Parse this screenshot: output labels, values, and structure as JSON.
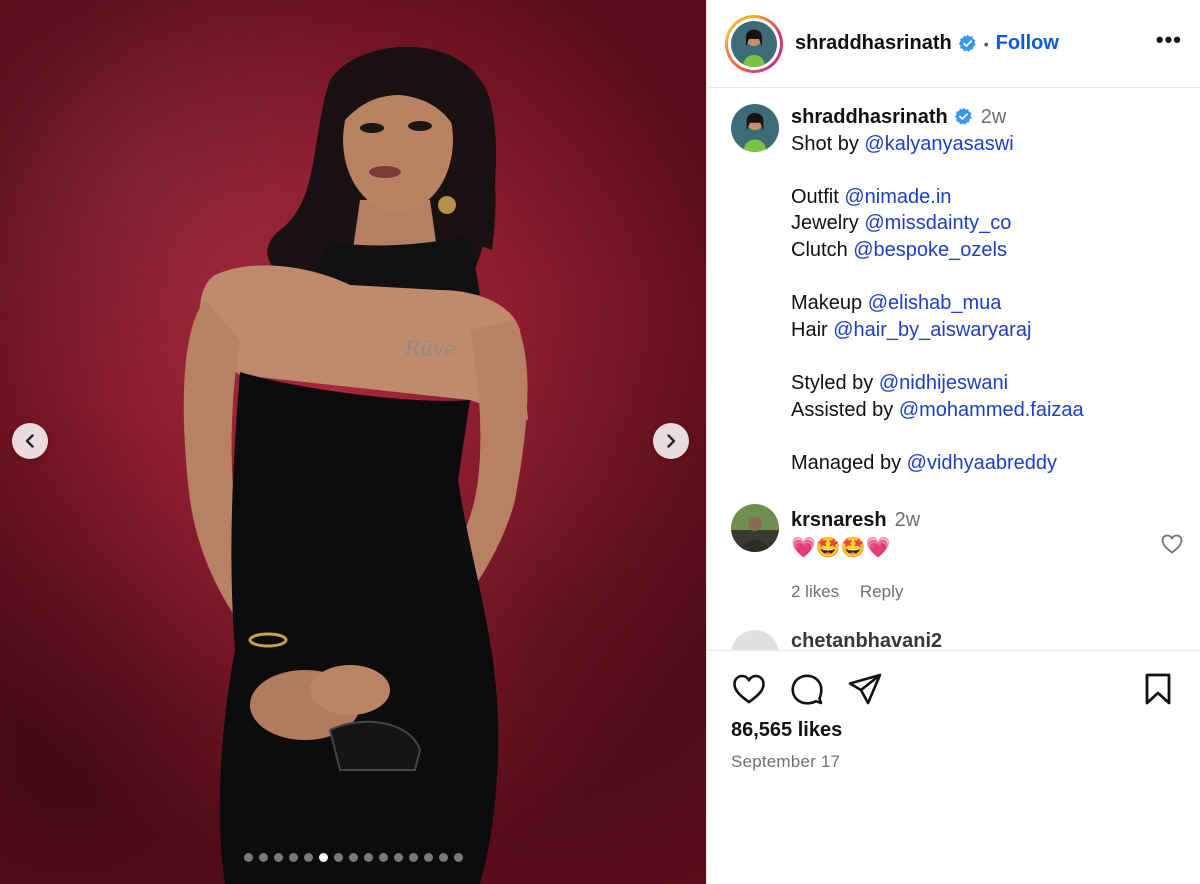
{
  "header": {
    "username": "shraddhasrinath",
    "separator": "•",
    "follow_label": "Follow",
    "more_label": "•••",
    "verified_color": "#3897f0"
  },
  "caption": {
    "username": "shraddhasrinath",
    "time": "2w",
    "lines": [
      {
        "prefix": "Shot by ",
        "mention": "@kalyanyasaswi"
      },
      {
        "blank": true
      },
      {
        "prefix": "Outfit ",
        "mention": "@nimade.in"
      },
      {
        "prefix": "Jewelry ",
        "mention": "@missdainty_co"
      },
      {
        "prefix": "Clutch ",
        "mention": "@bespoke_ozels"
      },
      {
        "blank": true
      },
      {
        "prefix": "Makeup ",
        "mention": "@elishab_mua"
      },
      {
        "prefix": "Hair ",
        "mention": "@hair_by_aiswaryaraj"
      },
      {
        "blank": true
      },
      {
        "prefix": "Styled by ",
        "mention": "@nidhijeswani"
      },
      {
        "prefix": "Assisted by ",
        "mention": "@mohammed.faizaa"
      },
      {
        "blank": true
      },
      {
        "prefix": "Managed by ",
        "mention": "@vidhyaabreddy"
      }
    ]
  },
  "comment": {
    "username": "krsnaresh",
    "time": "2w",
    "text": "💗🤩🤩💗",
    "likes": "2 likes",
    "reply_label": "Reply"
  },
  "peek_comment": {
    "username": "chetanbhavani2"
  },
  "post": {
    "likes": "86,565 likes",
    "date": "September 17"
  },
  "carousel": {
    "dot_count": 15,
    "active_index": 5
  },
  "colors": {
    "accent": "#0a5bd6",
    "mention": "#1d3fc7",
    "backdrop": "#8e1d2f"
  }
}
